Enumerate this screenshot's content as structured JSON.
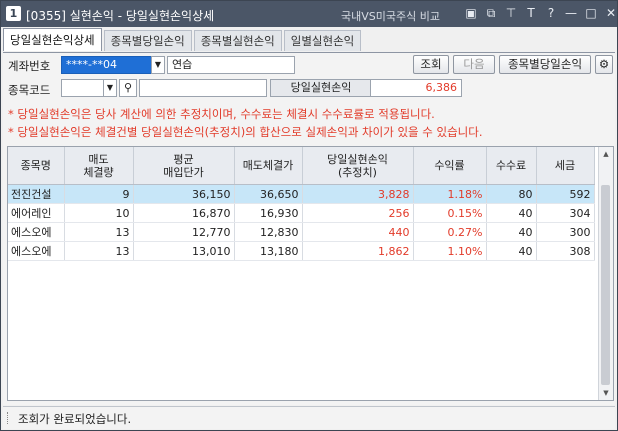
{
  "titlebar": {
    "number": "1",
    "title": "[0355] 실현손익 - 당일실현손익상세",
    "compare": "국내VS미국주식 비교",
    "icons": [
      "window-icon",
      "copy-icon",
      "pin-icon",
      "font-icon",
      "help-icon",
      "minimize-icon",
      "maximize-icon",
      "close-icon"
    ],
    "icon_glyphs": [
      "▣",
      "⧉",
      "⊤",
      "T",
      "?",
      "—",
      "□",
      "✕"
    ]
  },
  "tabs": [
    "당일실현손익상세",
    "종목별당일손익",
    "종목별실현손익",
    "일별실현손익"
  ],
  "form": {
    "account_label": "계좌번호",
    "account_value": "****-**04",
    "account_name": "연습",
    "stock_label": "종목코드",
    "pnl_label": "당일실현손익",
    "pnl_value": "6,386",
    "search_button": "조회",
    "next_button": "다음",
    "by_stock_button": "종목별당일손익"
  },
  "notes": [
    "* 당일실현손익은 당사 계산에 의한 추정치이며, 수수료는 체결시 수수료률로 적용됩니다.",
    "* 당일실현손익은 체결건별 당일실현손익(추정치)의 합산으로 실제손익과 차이가 있을 수 있습니다."
  ],
  "table": {
    "headers": [
      [
        "종목명",
        ""
      ],
      [
        "매도",
        "체결량"
      ],
      [
        "평균",
        "매입단가"
      ],
      [
        "매도체결가",
        ""
      ],
      [
        "당일실현손익",
        "(추정치)"
      ],
      [
        "수익률",
        ""
      ],
      [
        "수수료",
        ""
      ],
      [
        "세금",
        ""
      ]
    ],
    "rows": [
      [
        "전진건설",
        "9",
        "36,150",
        "36,650",
        "3,828",
        "1.18%",
        "80",
        "592"
      ],
      [
        "에어레인",
        "10",
        "16,870",
        "16,930",
        "256",
        "0.15%",
        "40",
        "304"
      ],
      [
        "에스오에",
        "13",
        "12,770",
        "12,830",
        "440",
        "0.27%",
        "40",
        "300"
      ],
      [
        "에스오에",
        "13",
        "13,010",
        "13,180",
        "1,862",
        "1.10%",
        "40",
        "308"
      ]
    ]
  },
  "status": "조회가 완료되었습니다.",
  "colors": {
    "accent_red": "#e23b2a",
    "selected_row": "#c7e6f8",
    "titlebar": "#4b5667",
    "account_select": "#1f6fd6"
  }
}
